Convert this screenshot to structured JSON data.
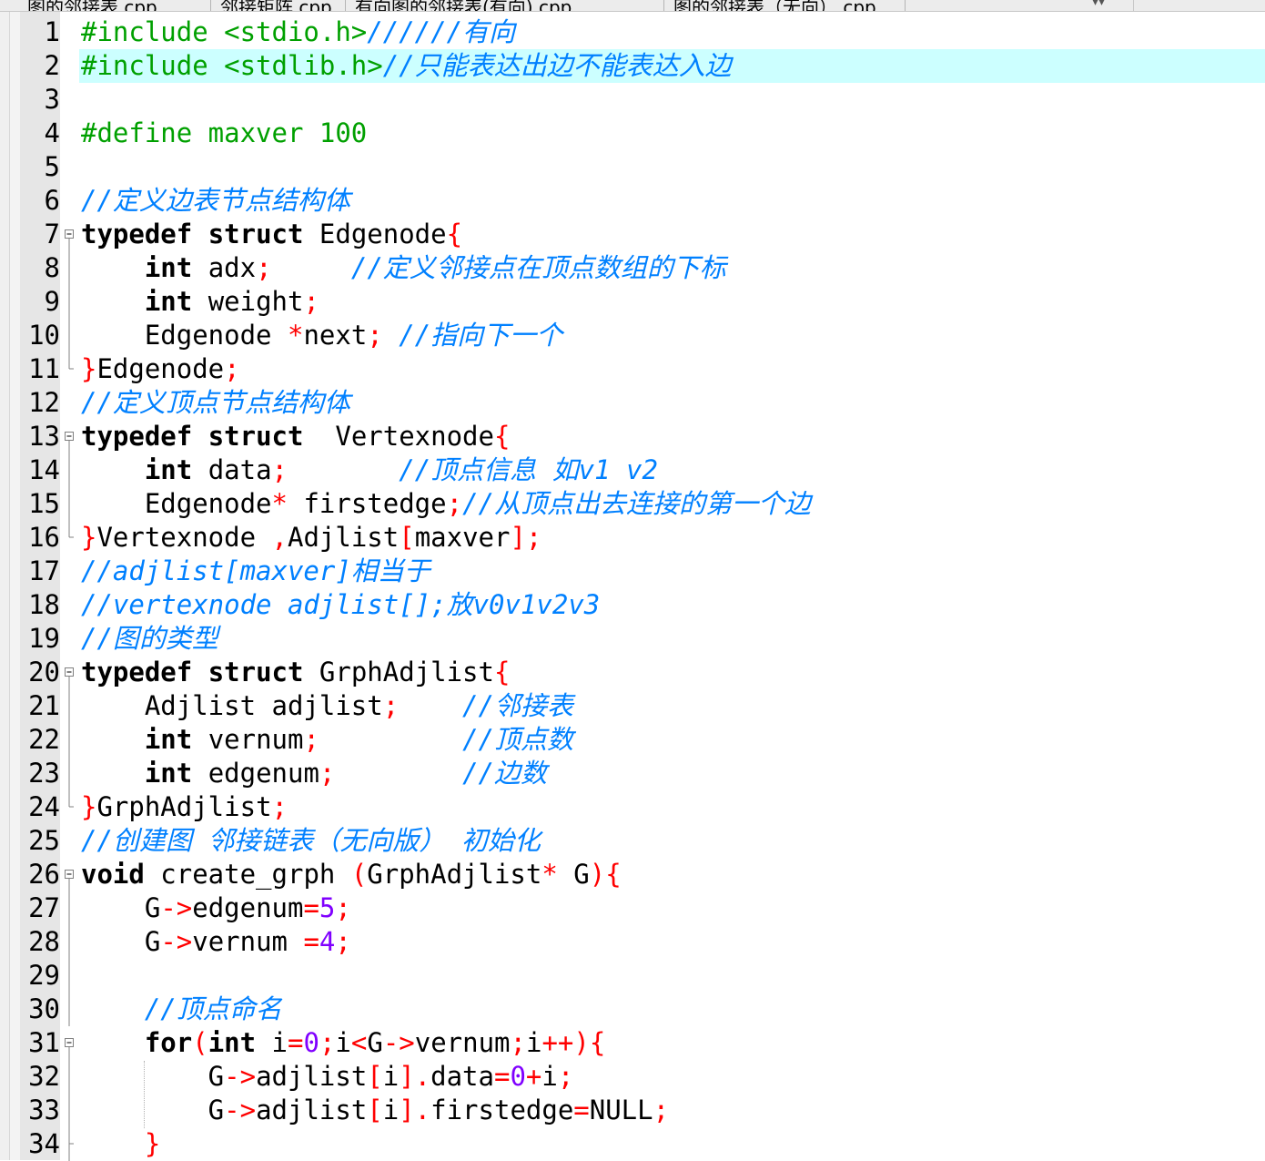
{
  "tabs": [
    {
      "label": "图的邻接表.cpp"
    },
    {
      "label": "邻接矩阵.cpp"
    },
    {
      "label": "有向图的邻接表(有向).cpp"
    },
    {
      "label": "图的邻接表（无向）.cpp"
    }
  ],
  "editor": {
    "current_line": 2,
    "lines": [
      {
        "n": "1",
        "fold": "",
        "tokens": [
          {
            "t": "#include <stdio.h>",
            "c": "pp"
          },
          {
            "t": "//////有向",
            "c": "cmt"
          }
        ]
      },
      {
        "n": "2",
        "fold": "",
        "tokens": [
          {
            "t": "#include <stdlib.h>",
            "c": "pp"
          },
          {
            "t": "//只能表达出边不能表达入边",
            "c": "cmt"
          }
        ]
      },
      {
        "n": "3",
        "fold": "",
        "tokens": []
      },
      {
        "n": "4",
        "fold": "",
        "tokens": [
          {
            "t": "#define maxver 100",
            "c": "pp"
          }
        ]
      },
      {
        "n": "5",
        "fold": "",
        "tokens": []
      },
      {
        "n": "6",
        "fold": "",
        "tokens": [
          {
            "t": "//定义边表节点结构体",
            "c": "cmt"
          }
        ]
      },
      {
        "n": "7",
        "fold": "open",
        "tokens": [
          {
            "t": "typedef",
            "c": "kw"
          },
          {
            "t": " "
          },
          {
            "t": "struct",
            "c": "kw"
          },
          {
            "t": " Edgenode"
          },
          {
            "t": "{",
            "c": "op"
          }
        ]
      },
      {
        "n": "8",
        "fold": "line",
        "tokens": [
          {
            "t": "    "
          },
          {
            "t": "int",
            "c": "kw"
          },
          {
            "t": " adx"
          },
          {
            "t": ";",
            "c": "op"
          },
          {
            "t": "     "
          },
          {
            "t": "//定义邻接点在顶点数组的下标",
            "c": "cmt"
          }
        ]
      },
      {
        "n": "9",
        "fold": "line",
        "tokens": [
          {
            "t": "    "
          },
          {
            "t": "int",
            "c": "kw"
          },
          {
            "t": " weight"
          },
          {
            "t": ";",
            "c": "op"
          }
        ]
      },
      {
        "n": "10",
        "fold": "line",
        "tokens": [
          {
            "t": "    Edgenode "
          },
          {
            "t": "*",
            "c": "op"
          },
          {
            "t": "next"
          },
          {
            "t": ";",
            "c": "op"
          },
          {
            "t": " "
          },
          {
            "t": "//指向下一个",
            "c": "cmt"
          }
        ]
      },
      {
        "n": "11",
        "fold": "end",
        "tokens": [
          {
            "t": "}",
            "c": "op"
          },
          {
            "t": "Edgenode"
          },
          {
            "t": ";",
            "c": "op"
          }
        ]
      },
      {
        "n": "12",
        "fold": "",
        "tokens": [
          {
            "t": "//定义顶点节点结构体",
            "c": "cmt"
          }
        ]
      },
      {
        "n": "13",
        "fold": "open",
        "tokens": [
          {
            "t": "typedef",
            "c": "kw"
          },
          {
            "t": " "
          },
          {
            "t": "struct",
            "c": "kw"
          },
          {
            "t": "  Vertexnode"
          },
          {
            "t": "{",
            "c": "op"
          }
        ]
      },
      {
        "n": "14",
        "fold": "line",
        "tokens": [
          {
            "t": "    "
          },
          {
            "t": "int",
            "c": "kw"
          },
          {
            "t": " data"
          },
          {
            "t": ";",
            "c": "op"
          },
          {
            "t": "       "
          },
          {
            "t": "//顶点信息 如v1 v2",
            "c": "cmt"
          }
        ]
      },
      {
        "n": "15",
        "fold": "line",
        "tokens": [
          {
            "t": "    Edgenode"
          },
          {
            "t": "*",
            "c": "op"
          },
          {
            "t": " firstedge"
          },
          {
            "t": ";",
            "c": "op"
          },
          {
            "t": "//从顶点出去连接的第一个边",
            "c": "cmt"
          }
        ]
      },
      {
        "n": "16",
        "fold": "end",
        "tokens": [
          {
            "t": "}",
            "c": "op"
          },
          {
            "t": "Vertexnode "
          },
          {
            "t": ",",
            "c": "op"
          },
          {
            "t": "Adjlist"
          },
          {
            "t": "[",
            "c": "op"
          },
          {
            "t": "maxver"
          },
          {
            "t": "];",
            "c": "op"
          }
        ]
      },
      {
        "n": "17",
        "fold": "",
        "tokens": [
          {
            "t": "//adjlist[maxver]相当于",
            "c": "cmt"
          }
        ]
      },
      {
        "n": "18",
        "fold": "",
        "tokens": [
          {
            "t": "//vertexnode adjlist[];放v0v1v2v3",
            "c": "cmt"
          }
        ]
      },
      {
        "n": "19",
        "fold": "",
        "tokens": [
          {
            "t": "//图的类型",
            "c": "cmt"
          }
        ]
      },
      {
        "n": "20",
        "fold": "open",
        "tokens": [
          {
            "t": "typedef",
            "c": "kw"
          },
          {
            "t": " "
          },
          {
            "t": "struct",
            "c": "kw"
          },
          {
            "t": " GrphAdjlist"
          },
          {
            "t": "{",
            "c": "op"
          }
        ]
      },
      {
        "n": "21",
        "fold": "line",
        "tokens": [
          {
            "t": "    Adjlist adjlist"
          },
          {
            "t": ";",
            "c": "op"
          },
          {
            "t": "    "
          },
          {
            "t": "//邻接表",
            "c": "cmt"
          }
        ]
      },
      {
        "n": "22",
        "fold": "line",
        "tokens": [
          {
            "t": "    "
          },
          {
            "t": "int",
            "c": "kw"
          },
          {
            "t": " vernum"
          },
          {
            "t": ";",
            "c": "op"
          },
          {
            "t": "         "
          },
          {
            "t": "//顶点数",
            "c": "cmt"
          }
        ]
      },
      {
        "n": "23",
        "fold": "line",
        "tokens": [
          {
            "t": "    "
          },
          {
            "t": "int",
            "c": "kw"
          },
          {
            "t": " edgenum"
          },
          {
            "t": ";",
            "c": "op"
          },
          {
            "t": "        "
          },
          {
            "t": "//边数",
            "c": "cmt"
          }
        ]
      },
      {
        "n": "24",
        "fold": "end",
        "tokens": [
          {
            "t": "}",
            "c": "op"
          },
          {
            "t": "GrphAdjlist"
          },
          {
            "t": ";",
            "c": "op"
          }
        ]
      },
      {
        "n": "25",
        "fold": "",
        "tokens": [
          {
            "t": "//创建图 邻接链表（无向版） 初始化",
            "c": "cmt"
          }
        ]
      },
      {
        "n": "26",
        "fold": "open",
        "tokens": [
          {
            "t": "void",
            "c": "kw"
          },
          {
            "t": " create_grph "
          },
          {
            "t": "(",
            "c": "op"
          },
          {
            "t": "GrphAdjlist"
          },
          {
            "t": "*",
            "c": "op"
          },
          {
            "t": " G"
          },
          {
            "t": "){",
            "c": "op"
          }
        ]
      },
      {
        "n": "27",
        "fold": "line",
        "tokens": [
          {
            "t": "    G"
          },
          {
            "t": "->",
            "c": "op"
          },
          {
            "t": "edgenum"
          },
          {
            "t": "=",
            "c": "op"
          },
          {
            "t": "5",
            "c": "num-lit"
          },
          {
            "t": ";",
            "c": "op"
          }
        ]
      },
      {
        "n": "28",
        "fold": "line",
        "tokens": [
          {
            "t": "    G"
          },
          {
            "t": "->",
            "c": "op"
          },
          {
            "t": "vernum "
          },
          {
            "t": "=",
            "c": "op"
          },
          {
            "t": "4",
            "c": "num-lit"
          },
          {
            "t": ";",
            "c": "op"
          }
        ]
      },
      {
        "n": "29",
        "fold": "line",
        "tokens": []
      },
      {
        "n": "30",
        "fold": "line",
        "tokens": [
          {
            "t": "    "
          },
          {
            "t": "//顶点命名",
            "c": "cmt"
          }
        ]
      },
      {
        "n": "31",
        "fold": "open",
        "tokens": [
          {
            "t": "    "
          },
          {
            "t": "for",
            "c": "kw"
          },
          {
            "t": "(",
            "c": "op"
          },
          {
            "t": "int",
            "c": "kw"
          },
          {
            "t": " i"
          },
          {
            "t": "=",
            "c": "op"
          },
          {
            "t": "0",
            "c": "num-lit"
          },
          {
            "t": ";",
            "c": "op"
          },
          {
            "t": "i"
          },
          {
            "t": "<",
            "c": "op"
          },
          {
            "t": "G"
          },
          {
            "t": "->",
            "c": "op"
          },
          {
            "t": "vernum"
          },
          {
            "t": ";",
            "c": "op"
          },
          {
            "t": "i"
          },
          {
            "t": "++){",
            "c": "op"
          }
        ]
      },
      {
        "n": "32",
        "fold": "line",
        "tokens": [
          {
            "t": "        G"
          },
          {
            "t": "->",
            "c": "op"
          },
          {
            "t": "adjlist"
          },
          {
            "t": "[",
            "c": "op"
          },
          {
            "t": "i"
          },
          {
            "t": "].",
            "c": "op"
          },
          {
            "t": "data"
          },
          {
            "t": "=",
            "c": "op"
          },
          {
            "t": "0",
            "c": "num-lit"
          },
          {
            "t": "+",
            "c": "op"
          },
          {
            "t": "i"
          },
          {
            "t": ";",
            "c": "op"
          }
        ]
      },
      {
        "n": "33",
        "fold": "line",
        "tokens": [
          {
            "t": "        G"
          },
          {
            "t": "->",
            "c": "op"
          },
          {
            "t": "adjlist"
          },
          {
            "t": "[",
            "c": "op"
          },
          {
            "t": "i"
          },
          {
            "t": "].",
            "c": "op"
          },
          {
            "t": "firstedge"
          },
          {
            "t": "=",
            "c": "op"
          },
          {
            "t": "NULL"
          },
          {
            "t": ";",
            "c": "op"
          }
        ]
      },
      {
        "n": "34",
        "fold": "mid",
        "tokens": [
          {
            "t": "    "
          },
          {
            "t": "}",
            "c": "op"
          }
        ]
      }
    ]
  }
}
